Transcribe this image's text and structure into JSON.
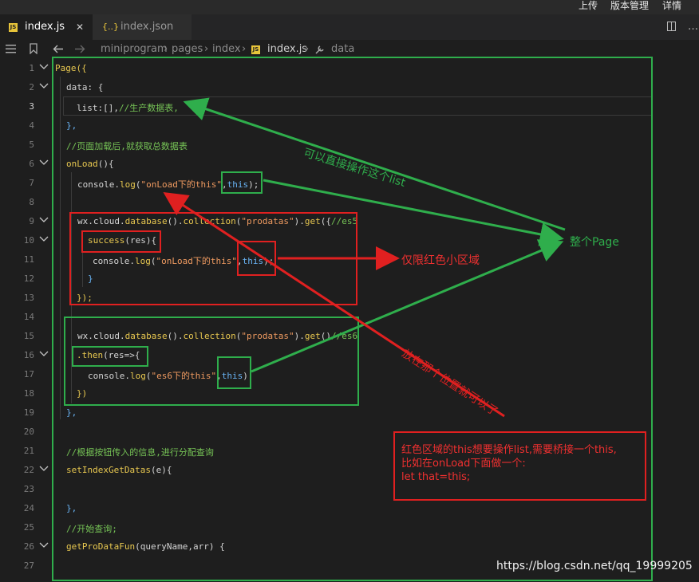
{
  "topbar": {
    "upload": "上传",
    "version": "版本管理",
    "details": "详情"
  },
  "tabs": [
    {
      "label": "index.js"
    },
    {
      "label": "index.json"
    }
  ],
  "tab_icons": {
    "js": "JS",
    "json": "{..}",
    "close": "✕"
  },
  "breadcrumb": {
    "p1": "miniprogram",
    "p2": "pages",
    "p3": "index",
    "p4": "index.js",
    "p5": "data",
    "sep": "›"
  },
  "lines": [
    {
      "num": "1",
      "fold": true
    },
    {
      "num": "2",
      "fold": true
    },
    {
      "num": "3",
      "fold": false,
      "active": true
    },
    {
      "num": "4",
      "fold": false
    },
    {
      "num": "5",
      "fold": false
    },
    {
      "num": "6",
      "fold": true
    },
    {
      "num": "7",
      "fold": false
    },
    {
      "num": "8",
      "fold": false
    },
    {
      "num": "9",
      "fold": true
    },
    {
      "num": "10",
      "fold": true
    },
    {
      "num": "11",
      "fold": false
    },
    {
      "num": "12",
      "fold": false
    },
    {
      "num": "13",
      "fold": false
    },
    {
      "num": "14",
      "fold": false
    },
    {
      "num": "15",
      "fold": false
    },
    {
      "num": "16",
      "fold": true
    },
    {
      "num": "17",
      "fold": false
    },
    {
      "num": "18",
      "fold": false
    },
    {
      "num": "19",
      "fold": false
    },
    {
      "num": "20",
      "fold": false
    },
    {
      "num": "21",
      "fold": false
    },
    {
      "num": "22",
      "fold": true
    },
    {
      "num": "23",
      "fold": false
    },
    {
      "num": "24",
      "fold": false
    },
    {
      "num": "25",
      "fold": false
    },
    {
      "num": "26",
      "fold": true
    },
    {
      "num": "27",
      "fold": false
    }
  ],
  "code": {
    "l1a": "Page",
    "l1b": "({",
    "l2a": "data",
    "l2b": ": {",
    "l3a": "list",
    ":l3": "",
    "l3b": ":[],",
    "l3c": "//生产数据表,",
    "l4": "},",
    "l5": "//页面加载后,就获取总数据表",
    "l6a": "onLoad",
    "l6b": "(){",
    "l7a": "console",
    "l7b": ".",
    "l7c": "log",
    "l7d": "(",
    "l7e": "\"onLoad下的this\"",
    "l7f": ",",
    "l7g": "this",
    "l7h": ");",
    "l9a": "wx",
    "l9b": ".",
    "l9c": "cloud",
    "l9d": ".",
    "l9e": "database",
    "l9f": "().",
    "l9g": "collection",
    "l9h": "(",
    "l9i": "\"prodatas\"",
    "l9j": ").",
    "l9k": "get",
    "l9l": "({",
    "l9m": "//es5",
    "l10a": "success",
    "l10b": "(",
    "l10c": "res",
    "l10d": "){",
    "l11a": "console",
    "l11b": ".",
    "l11c": "log",
    "l11d": "(",
    "l11e": "\"onLoad下的this\"",
    "l11f": ",",
    "l11g": "this",
    "l11h": ");",
    "l12": "}",
    "l13": "});",
    "l15a": "wx",
    "l15b": ".",
    "l15c": "cloud",
    "l15d": ".",
    "l15e": "database",
    "l15f": "().",
    "l15g": "collection",
    "l15h": "(",
    "l15i": "\"prodatas\"",
    "l15j": ").",
    "l15k": "get",
    "l15l": "()",
    "l15m": "//es6",
    "l16a": ".then",
    "l16b": "(",
    "l16c": "res",
    "l16d": "=>{",
    "l17a": "console",
    "l17b": ".",
    "l17c": "log",
    "l17d": "(",
    "l17e": "\"es6下的this\"",
    "l17f": ",",
    "l17g": "this",
    "l17h": ")",
    "l18": "})",
    "l19": "},",
    "l21": "//根据按钮传入的信息,进行分配查询",
    "l22a": "setIndexGetDatas",
    "l22b": "(",
    "l22c": "e",
    "l22d": "){",
    "l24": "},",
    "l25": "//开始查询;",
    "l26a": "getProDataFun",
    "l26b": "(",
    "l26c": "queryName",
    "l26d": ",",
    "l26e": "arr",
    "l26f": ") {"
  },
  "annotations": {
    "direct_list": "可以直接操作这个list",
    "whole_page": "整个Page",
    "red_only": "仅限红色小区域",
    "anywhere": "放在那个位置就可以了",
    "note_lines": [
      "红色区域的this想要操作list,需要桥接一个this,",
      "比如在onLoad下面做一个:",
      "let that=this;"
    ]
  },
  "watermark": "https://blog.csdn.net/qq_19999205",
  "colors": {
    "green": "#2fae4c",
    "red": "#e02020",
    "bg": "#1e1e1e"
  }
}
